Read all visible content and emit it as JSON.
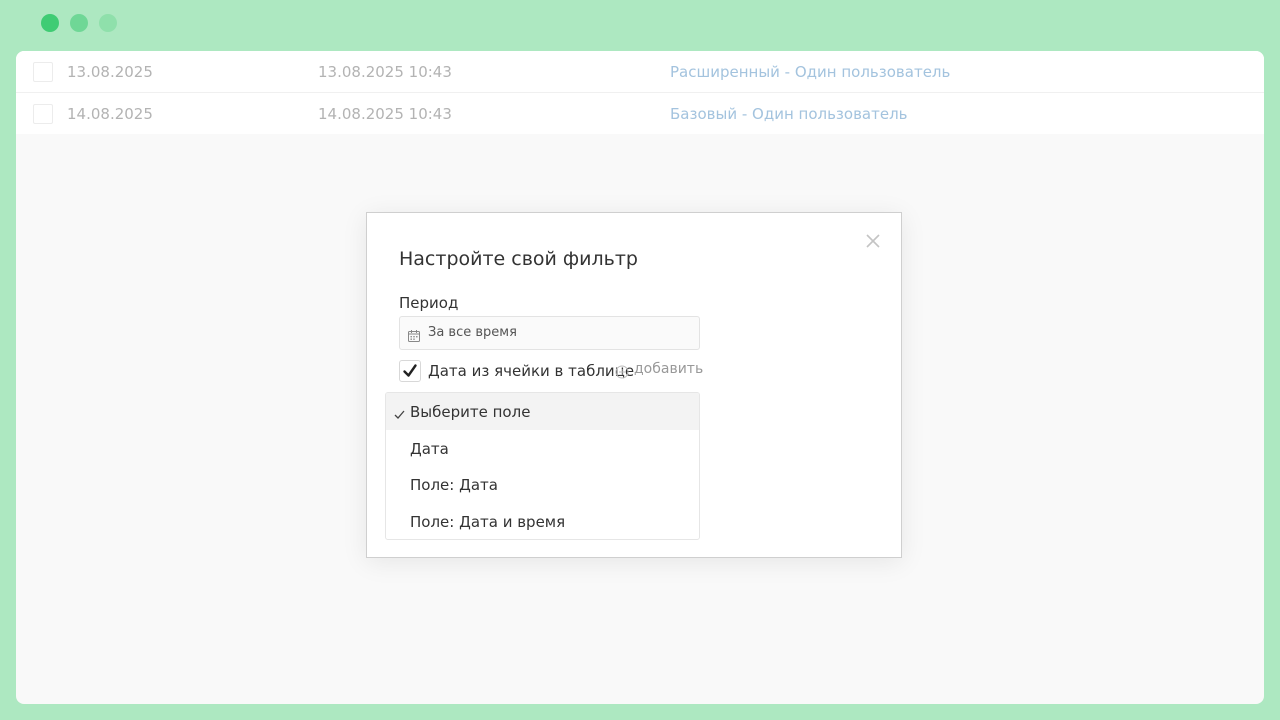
{
  "window_controls": [
    "close",
    "minimize",
    "maximize"
  ],
  "colors": {
    "frame": "#ade8c1",
    "dot_close": "#3fcc74",
    "dot_minimize": "#6fd796",
    "dot_maximize": "#8fe0ab",
    "link": "#a3c3de"
  },
  "table": {
    "rows": [
      {
        "date": "13.08.2025",
        "datetime": "13.08.2025 10:43",
        "plan": "Расширенный - Один пользователь"
      },
      {
        "date": "14.08.2025",
        "datetime": "14.08.2025 10:43",
        "plan": "Базовый - Один пользователь"
      }
    ]
  },
  "modal": {
    "title": "Настройте свой фильтр",
    "period_label": "Период",
    "period_value": "За все время",
    "period_icon": "calendar-icon",
    "checkbox_label": "Дата из ячейки в таблице",
    "checkbox_checked": true,
    "add_label": "добавить",
    "close_icon": "close-icon",
    "dropdown": {
      "options": [
        {
          "label": "Выберите поле",
          "selected": true
        },
        {
          "label": "Дата",
          "selected": false
        },
        {
          "label": "Поле: Дата",
          "selected": false
        },
        {
          "label": "Поле: Дата и время",
          "selected": false
        }
      ]
    }
  }
}
